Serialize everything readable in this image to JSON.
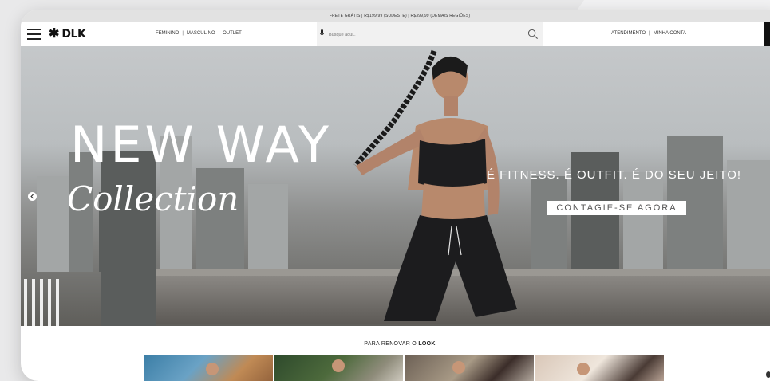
{
  "topbar": {
    "shipping_text": "FRETE GRÁTIS | R$199,99 (SUDESTE) | R$399,99 (DEMAIS REGIÕES)"
  },
  "header": {
    "logo_text": "DLK",
    "nav": [
      {
        "label": "FEMININO"
      },
      {
        "label": "MASCULINO"
      },
      {
        "label": "OUTLET"
      }
    ],
    "search": {
      "placeholder": "Busque aqui..",
      "value": ""
    },
    "service_links": [
      {
        "label": "ATENDIMENTO"
      },
      {
        "label": "MINHA CONTA"
      }
    ],
    "separator": "|"
  },
  "hero": {
    "headline": "NEW WAY",
    "script": "Collection",
    "tagline": "É FITNESS. É OUTFIT. É DO SEU JEITO!",
    "cta_label": "CONTAGIE-SE AGORA"
  },
  "section": {
    "title_prefix": "PARA RENOVAR O ",
    "title_bold": "LOOK"
  },
  "icons": [
    "menu-icon",
    "logo-mark-icon",
    "microphone-icon",
    "search-icon",
    "chevron-left-icon"
  ],
  "colors": {
    "accent_dark": "#111111",
    "topbar_bg": "#e2e2e2",
    "search_bg": "#f1f1f1"
  }
}
